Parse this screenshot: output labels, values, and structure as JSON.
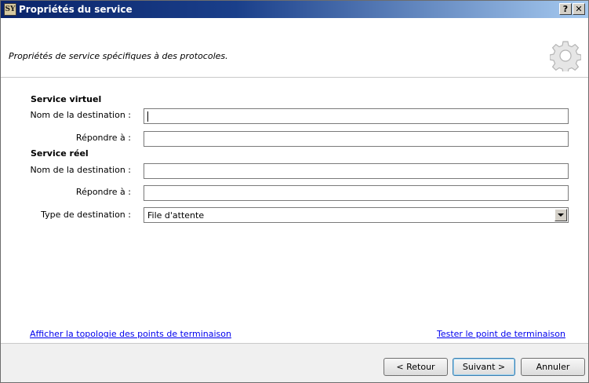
{
  "window": {
    "icon_text": "SY",
    "title": "Propriétés du service",
    "help_label": "?",
    "close_label": "✕"
  },
  "header": {
    "description": "Propriétés de service spécifiques à des protocoles.",
    "icon": "gear-icon"
  },
  "virtual_service": {
    "section_title": "Service virtuel",
    "destination_name_label": "Nom de la destination :",
    "destination_name_value": "",
    "reply_to_label": "Répondre à :",
    "reply_to_value": ""
  },
  "real_service": {
    "section_title": "Service réel",
    "destination_name_label": "Nom de la destination :",
    "destination_name_value": "",
    "reply_to_label": "Répondre à :",
    "reply_to_value": "",
    "destination_type_label": "Type de destination :",
    "destination_type_value": "File d'attente"
  },
  "links": {
    "show_topology": "Afficher la topologie des points de terminaison",
    "test_endpoint": "Tester le point de terminaison"
  },
  "footer": {
    "back_label": "< Retour",
    "next_label": "Suivant >",
    "cancel_label": "Annuler"
  }
}
